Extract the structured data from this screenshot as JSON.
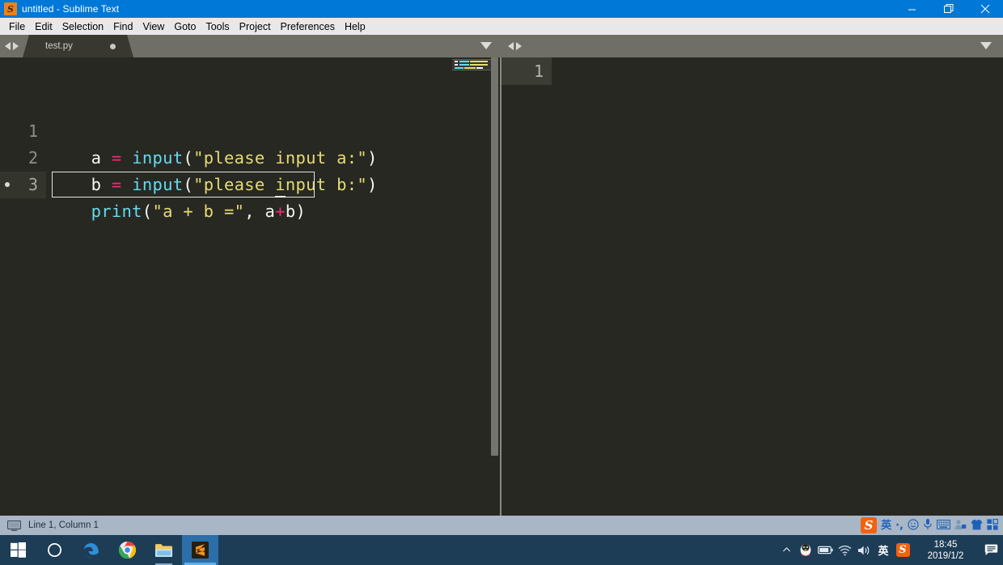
{
  "window": {
    "title": "untitled - Sublime Text",
    "app_icon": "sublime-text-icon",
    "controls": {
      "minimize": "minimize-button",
      "restore": "restore-button",
      "close": "close-button"
    }
  },
  "menubar": {
    "items": [
      {
        "label": "File"
      },
      {
        "label": "Edit"
      },
      {
        "label": "Selection"
      },
      {
        "label": "Find"
      },
      {
        "label": "View"
      },
      {
        "label": "Goto"
      },
      {
        "label": "Tools"
      },
      {
        "label": "Project"
      },
      {
        "label": "Preferences"
      },
      {
        "label": "Help"
      }
    ]
  },
  "tabs": {
    "left_pane": {
      "active_tab": "test.py",
      "dirty": true
    }
  },
  "editor": {
    "left_pane": {
      "lines": [
        {
          "number": "1",
          "tokens": [
            {
              "text": "a",
              "type": "plain"
            },
            {
              "text": " ",
              "type": "plain"
            },
            {
              "text": "=",
              "type": "op"
            },
            {
              "text": " ",
              "type": "plain"
            },
            {
              "text": "input",
              "type": "fn"
            },
            {
              "text": "(",
              "type": "punc"
            },
            {
              "text": "\"please input a:\"",
              "type": "str"
            },
            {
              "text": ")",
              "type": "punc"
            }
          ]
        },
        {
          "number": "2",
          "tokens": [
            {
              "text": "b",
              "type": "plain"
            },
            {
              "text": " ",
              "type": "plain"
            },
            {
              "text": "=",
              "type": "op"
            },
            {
              "text": " ",
              "type": "plain"
            },
            {
              "text": "input",
              "type": "fn"
            },
            {
              "text": "(",
              "type": "punc"
            },
            {
              "text": "\"please input b:\"",
              "type": "str"
            },
            {
              "text": ")",
              "type": "punc"
            }
          ]
        },
        {
          "number": "3",
          "active": true,
          "tokens": [
            {
              "text": "print",
              "type": "fn"
            },
            {
              "text": "(",
              "type": "punc"
            },
            {
              "text": "\"a + b =\"",
              "type": "str"
            },
            {
              "text": ",",
              "type": "punc"
            },
            {
              "text": " ",
              "type": "plain"
            },
            {
              "text": "a",
              "type": "plain"
            },
            {
              "text": "+",
              "type": "op"
            },
            {
              "text": "b",
              "type": "plain"
            },
            {
              "text": ")",
              "type": "punc"
            }
          ]
        }
      ]
    },
    "right_pane": {
      "lines": [
        {
          "number": "1",
          "active": true,
          "tokens": []
        }
      ]
    }
  },
  "statusbar": {
    "icon": "display-icon",
    "position_text": "Line 1, Column 1"
  },
  "ime_toolbar": {
    "logo": "S",
    "items": [
      {
        "name": "language-mode-icon",
        "glyph": "英"
      },
      {
        "name": "punctuation-mode-icon",
        "glyph": "·,"
      },
      {
        "name": "emoji-icon",
        "glyph": "☺"
      },
      {
        "name": "microphone-icon",
        "glyph": "🎤"
      },
      {
        "name": "soft-keyboard-icon",
        "glyph": "⌨"
      },
      {
        "name": "user-account-icon",
        "glyph": "👤"
      },
      {
        "name": "skin-icon",
        "glyph": "👕"
      },
      {
        "name": "toolbox-icon",
        "glyph": "▦"
      }
    ]
  },
  "taskbar": {
    "apps": [
      {
        "name": "start-button",
        "label": "Windows"
      },
      {
        "name": "cortana-search-button",
        "label": "Cortana"
      },
      {
        "name": "edge-button",
        "label": "Microsoft Edge"
      },
      {
        "name": "chrome-button",
        "label": "Google Chrome"
      },
      {
        "name": "file-explorer-button",
        "label": "File Explorer"
      },
      {
        "name": "sublime-text-button",
        "label": "Sublime Text"
      }
    ],
    "tray": [
      {
        "name": "show-hidden-icons-chevron",
        "glyph": "^"
      },
      {
        "name": "qq-icon",
        "glyph": ""
      },
      {
        "name": "battery-icon",
        "glyph": ""
      },
      {
        "name": "network-icon",
        "glyph": ""
      },
      {
        "name": "volume-icon",
        "glyph": ""
      },
      {
        "name": "ime-indicator",
        "glyph": "英"
      },
      {
        "name": "sogou-tray-icon",
        "glyph": "S"
      }
    ],
    "clock": {
      "time": "18:45",
      "date": "2019/1/2"
    },
    "action_center": "notifications-icon"
  },
  "colors": {
    "accent": "#0078d7",
    "editor_bg": "#272822",
    "keyword": "#f92672",
    "function": "#66d9ef",
    "string": "#e6db74",
    "plain": "#f8f8f2",
    "statusbar_bg": "#a9b6c6",
    "taskbar_bg": "#1d3c56"
  }
}
